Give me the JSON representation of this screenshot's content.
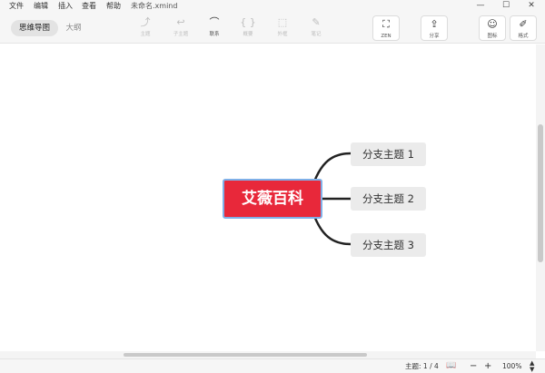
{
  "menubar": {
    "items": [
      "文件",
      "编辑",
      "插入",
      "查看",
      "帮助"
    ],
    "doc_title": "未命名.xmind"
  },
  "window_controls": {
    "minimize": "—",
    "maximize": "☐",
    "close": "✕"
  },
  "toolbar": {
    "view_tabs": [
      {
        "label": "思维导图",
        "active": true
      },
      {
        "label": "大纲",
        "active": false
      }
    ],
    "tools": [
      {
        "glyph": "⤴",
        "label": "主题"
      },
      {
        "glyph": "↩",
        "label": "子主题"
      },
      {
        "glyph": "⌒",
        "label": "联系"
      },
      {
        "glyph": "{ }",
        "label": "概要"
      },
      {
        "glyph": "⬚",
        "label": "外框"
      },
      {
        "glyph": "✎",
        "label": "笔记"
      },
      {
        "glyph": "⛶",
        "label": "ZEN"
      },
      {
        "glyph": "⇪",
        "label": "分享"
      },
      {
        "glyph": "☺",
        "label": "图标"
      },
      {
        "glyph": "✐",
        "label": "格式"
      }
    ]
  },
  "mindmap": {
    "central_topic": "艾薇百科",
    "branches": [
      "分支主题 1",
      "分支主题 2",
      "分支主题 3"
    ],
    "colors": {
      "central_fill": "#e8283a",
      "central_border": "#7fb0e8",
      "branch_fill": "#ebebeb",
      "connector": "#222222"
    }
  },
  "statusbar": {
    "topic_count": "主题: 1 / 4",
    "book_icon": "📖",
    "zoom_out": "−",
    "zoom_in": "+",
    "zoom_level": "100%",
    "stepper_up": "▲",
    "stepper_down": "▼"
  }
}
